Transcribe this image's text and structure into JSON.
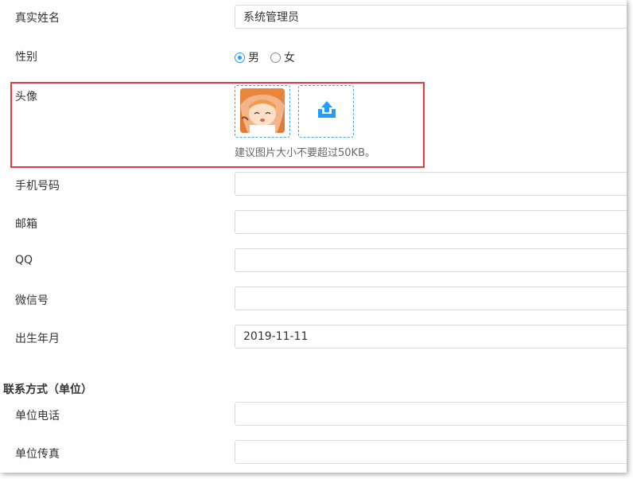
{
  "form": {
    "real_name": {
      "label": "真实姓名",
      "value": "系统管理员"
    },
    "gender": {
      "label": "性别",
      "options": [
        {
          "label": "男",
          "checked": true
        },
        {
          "label": "女",
          "checked": false
        }
      ]
    },
    "avatar": {
      "label": "头像",
      "hint": "建议图片大小不要超过50KB。",
      "upload_icon": "upload-icon",
      "accent_color": "#1e9fff"
    },
    "phone": {
      "label": "手机号码",
      "value": ""
    },
    "email": {
      "label": "邮箱",
      "value": ""
    },
    "qq": {
      "label": "QQ",
      "value": ""
    },
    "wechat": {
      "label": "微信号",
      "value": ""
    },
    "birth": {
      "label": "出生年月",
      "value": "2019-11-11"
    }
  },
  "contact_section": {
    "title": "联系方式（单位）",
    "work_phone": {
      "label": "单位电话",
      "value": ""
    },
    "work_fax": {
      "label": "单位传真",
      "value": ""
    }
  },
  "highlight_color": "#e0393e"
}
